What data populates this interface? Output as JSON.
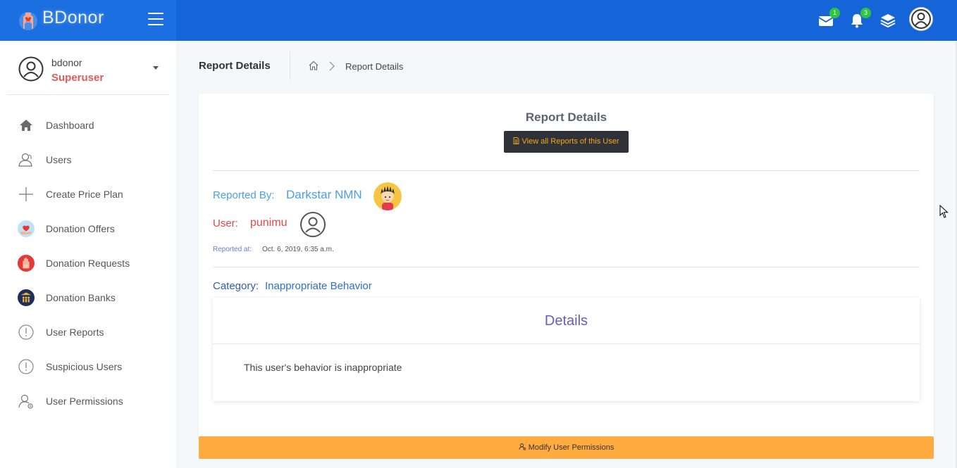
{
  "app": {
    "brand_name": "BDonor"
  },
  "topbar": {
    "mail_badge": "1",
    "notifications_badge": "3",
    "icons": [
      "menu-icon",
      "mail-icon",
      "bell-icon",
      "layers-icon",
      "user-avatar-icon"
    ]
  },
  "sidebar": {
    "profile": {
      "username": "bdonor",
      "role": "Superuser"
    },
    "items": [
      {
        "label": "Dashboard",
        "icon": "home-icon"
      },
      {
        "label": "Users",
        "icon": "users-icon"
      },
      {
        "label": "Create Price Plan",
        "icon": "plus-icon"
      },
      {
        "label": "Donation Offers",
        "icon": "heart-hand-icon"
      },
      {
        "label": "Donation Requests",
        "icon": "raised-hand-icon"
      },
      {
        "label": "Donation Banks",
        "icon": "bank-people-icon"
      },
      {
        "label": "User Reports",
        "icon": "alert-circle-icon"
      },
      {
        "label": "Suspicious Users",
        "icon": "alert-circle-icon"
      },
      {
        "label": "User Permissions",
        "icon": "user-settings-icon"
      }
    ]
  },
  "header": {
    "title": "Report Details",
    "breadcrumb_current": "Report Details"
  },
  "report": {
    "title": "Report Details",
    "view_all_button": "View all Reports of this User",
    "reported_by_label": "Reported By:",
    "reported_by_name": "Darkstar NMN",
    "user_label": "User:",
    "user_name": "punimu",
    "reported_at_label": "Reported at:",
    "reported_at_value": "Oct. 6, 2019, 6:35 a.m.",
    "category_label": "Category:",
    "category_value": "Inappropriate Behavior",
    "details_title": "Details",
    "details_text": "This user's behavior is inappropriate",
    "modify_button": "Modify User Permissions"
  },
  "colors": {
    "topbar": "#1565d8",
    "accent_orange": "#ffab40",
    "reporter_blue": "#4a9fea",
    "user_red": "#e04848",
    "superuser_red": "#e05a5a",
    "details_purple": "#6a5bbf",
    "dark_button": "#2f3236",
    "badge_green": "#2ec53f"
  }
}
